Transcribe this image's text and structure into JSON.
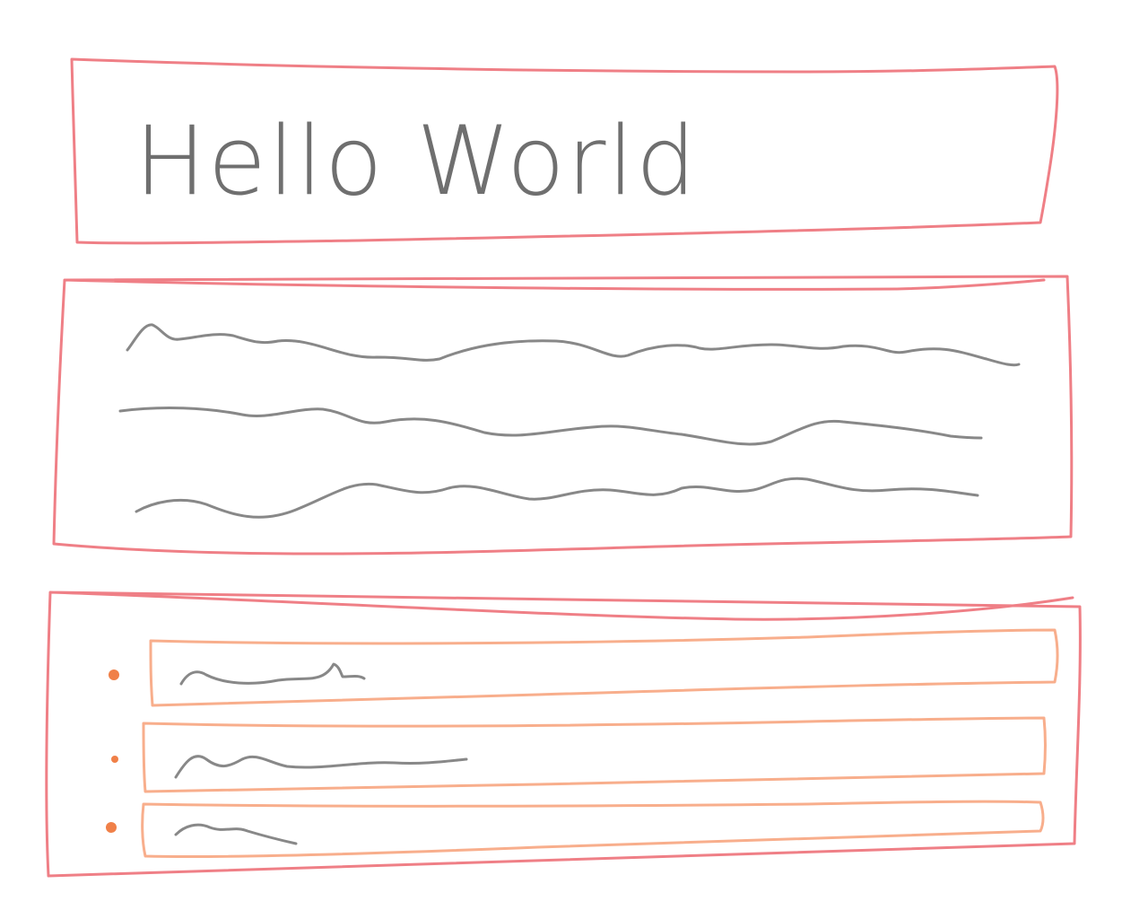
{
  "header": {
    "title": "Hello World"
  },
  "colors": {
    "section_border": "#ef7f86",
    "list_item_border": "#f8ae8c",
    "bullet": "#f08048",
    "scribble": "#888888",
    "title_text": "#6f6f6f",
    "background": "#ffffff"
  },
  "paragraph": {
    "line_count": 3
  },
  "list": {
    "item_count": 3
  }
}
